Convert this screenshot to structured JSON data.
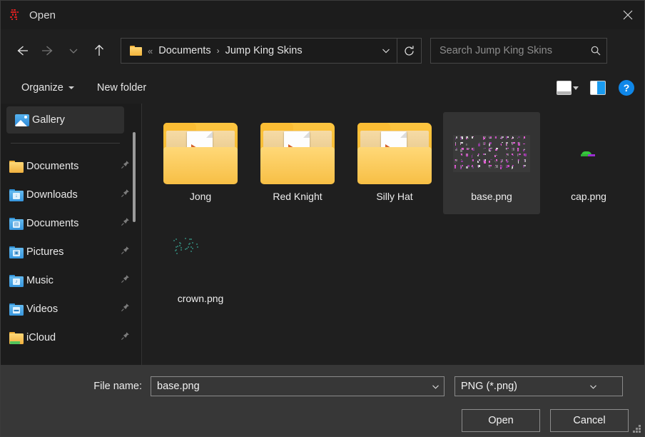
{
  "window": {
    "title": "Open",
    "app_icon": "jump-king-sprite-icon",
    "close_label": "✕"
  },
  "nav": {
    "back": "back-arrow",
    "forward": "forward-arrow",
    "recent": "chevron-down",
    "up": "up-arrow",
    "refresh": "refresh-icon"
  },
  "breadcrumb": {
    "overflow": "«",
    "separator": "›",
    "items": [
      "Documents",
      "Jump King Skins"
    ]
  },
  "search": {
    "placeholder": "Search Jump King Skins",
    "value": "",
    "icon": "search-icon"
  },
  "toolbar": {
    "organize_label": "Organize",
    "new_folder_label": "New folder",
    "view_icon": "view-mode-icon",
    "preview_pane_icon": "preview-pane-icon",
    "help_label": "?"
  },
  "sidebar": {
    "gallery": {
      "label": "Gallery",
      "icon": "gallery-icon"
    },
    "items": [
      {
        "label": "Documents",
        "icon": "folder-yellow-icon",
        "pinned": true,
        "glyph": ""
      },
      {
        "label": "Downloads",
        "icon": "folder-blue-download-icon",
        "pinned": true,
        "glyph": "↓"
      },
      {
        "label": "Documents",
        "icon": "folder-blue-document-icon",
        "pinned": true,
        "glyph": "▤"
      },
      {
        "label": "Pictures",
        "icon": "folder-blue-pictures-icon",
        "pinned": true,
        "glyph": "▣"
      },
      {
        "label": "Music",
        "icon": "folder-blue-music-icon",
        "pinned": true,
        "glyph": "♪"
      },
      {
        "label": "Videos",
        "icon": "folder-blue-videos-icon",
        "pinned": true,
        "glyph": "▬"
      },
      {
        "label": "iCloud",
        "icon": "folder-yellow-icloud-icon",
        "pinned": true,
        "glyph": ""
      }
    ]
  },
  "files": [
    {
      "name": "Jong",
      "type": "folder",
      "selected": false
    },
    {
      "name": "Red Knight",
      "type": "folder",
      "selected": false
    },
    {
      "name": "Silly Hat",
      "type": "folder",
      "selected": false
    },
    {
      "name": "base.png",
      "type": "image-spritesheet",
      "selected": true
    },
    {
      "name": "cap.png",
      "type": "image-small",
      "selected": false
    },
    {
      "name": "crown.png",
      "type": "image-dots",
      "selected": false
    }
  ],
  "footer": {
    "file_name_label": "File name:",
    "file_name_value": "base.png",
    "file_type_value": "PNG (*.png)",
    "open_label": "Open",
    "cancel_label": "Cancel"
  },
  "colors": {
    "accent_blue": "#0f87e8",
    "folder_yellow": "#f5b429",
    "window_bg": "#1f1f1f",
    "footer_bg": "#373737",
    "selection": "#333333"
  }
}
